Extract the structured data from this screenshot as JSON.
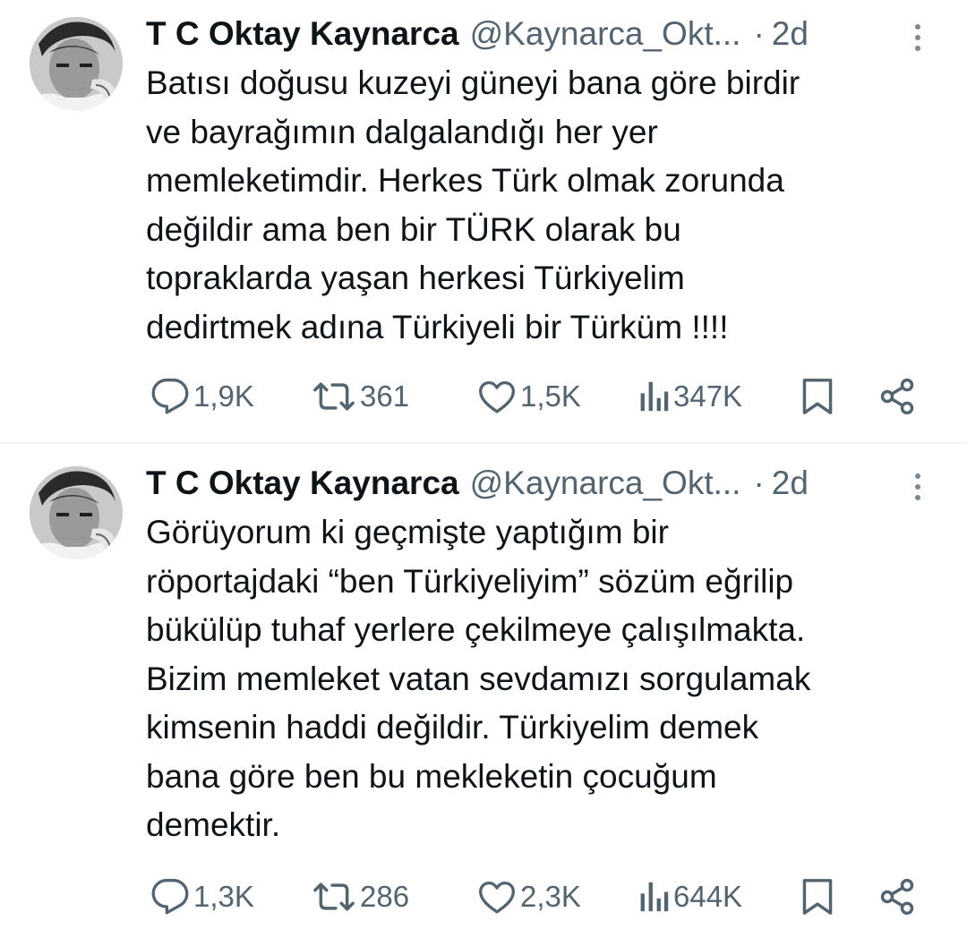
{
  "tweets": [
    {
      "author": {
        "display_name": "T C Oktay Kaynarca",
        "handle": "@Kaynarca_Okt...",
        "avatar_icon": "profile-photo"
      },
      "separator": "·",
      "time": "2d",
      "text": "Batısı doğusu kuzeyi güneyi bana göre birdir\nve bayrağımın dalgalandığı her yer\nmemleketimdir. Herkes Türk olmak zorunda\ndeğildir ama ben bir TÜRK olarak bu\ntopraklarda yaşan herkesi Türkiyelim\ndedirtmek adına Türkiyeli bir Türküm !!!!",
      "stats": {
        "replies": "1,9K",
        "retweets": "361",
        "likes": "1,5K",
        "views": "347K"
      }
    },
    {
      "author": {
        "display_name": "T C Oktay Kaynarca",
        "handle": "@Kaynarca_Okt...",
        "avatar_icon": "profile-photo"
      },
      "separator": "·",
      "time": "2d",
      "text": "Görüyorum ki geçmişte yaptığım bir\nröportajdaki “ben Türkiyeliyim” sözüm eğrilip\nbükülüp tuhaf yerlere çekilmeye çalışılmakta.\nBizim memleket vatan sevdamızı sorgulamak\nkimsenin haddi değildir. Türkiyelim demek\nbana göre ben bu mekleketin çocuğum\ndemektir.",
      "stats": {
        "replies": "1,3K",
        "retweets": "286",
        "likes": "2,3K",
        "views": "644K"
      }
    }
  ],
  "icons": {
    "reply": "reply-icon",
    "retweet": "retweet-icon",
    "like": "like-icon",
    "views": "views-icon",
    "bookmark": "bookmark-icon",
    "share": "share-icon",
    "more": "more-icon"
  },
  "colors": {
    "text": "#0f1419",
    "secondary": "#536471",
    "divider": "#eff3f4"
  }
}
